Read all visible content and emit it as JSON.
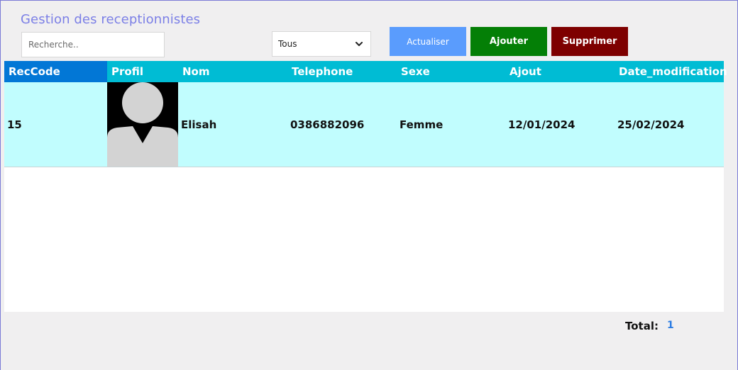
{
  "header": {
    "title": "Gestion des receptionnistes"
  },
  "toolbar": {
    "search_placeholder": "Recherche..",
    "filter_selected": "Tous",
    "refresh_label": "Actualiser",
    "add_label": "Ajouter",
    "delete_label": "Supprimer"
  },
  "colors": {
    "title": "#7b7fe6",
    "refresh": "#5a9cfd",
    "add": "#047f06",
    "delete": "#7e0000",
    "header": "#00bcd4",
    "header_selected": "#0277d6",
    "row": "#c1fdfe"
  },
  "table": {
    "columns": [
      "RecCode",
      "Profil",
      "Nom",
      "Telephone",
      "Sexe",
      "Ajout",
      "Date_modification"
    ],
    "rows": [
      {
        "reccode": "15",
        "profil_icon": "user-avatar-icon",
        "nom": "Elisah",
        "telephone": "0386882096",
        "sexe": "Femme",
        "ajout": "12/01/2024",
        "date_modification": "25/02/2024"
      }
    ]
  },
  "footer": {
    "total_label": "Total:",
    "total_value": "1"
  }
}
